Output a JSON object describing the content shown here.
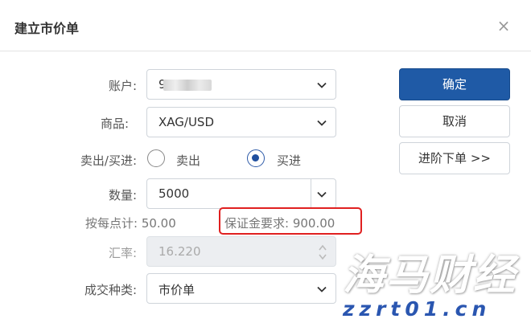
{
  "dialog": {
    "title": "建立市价单",
    "close_glyph": "×"
  },
  "form": {
    "account_label": "账户:",
    "account_value_visible": "9",
    "symbol_label": "商品:",
    "symbol_value": "XAG/USD",
    "side_label": "卖出/买进:",
    "sell_label": "卖出",
    "buy_label": "买进",
    "selected_side": "买进",
    "qty_label": "数量:",
    "qty_value": "5000",
    "per_point_label": "按每点计: 50.00",
    "margin_label": "保证金要求: 900.00",
    "rate_label": "汇率:",
    "rate_value": "16.220",
    "order_type_label": "成交种类:",
    "order_type_value": "市价单"
  },
  "buttons": {
    "ok": "确定",
    "cancel": "取消",
    "advanced": "进阶下单 >>"
  },
  "watermark": {
    "big": "海马财经",
    "small": "zzrt01.cn"
  },
  "colors": {
    "primary": "#1f5aa6",
    "highlight": "#e02020"
  }
}
